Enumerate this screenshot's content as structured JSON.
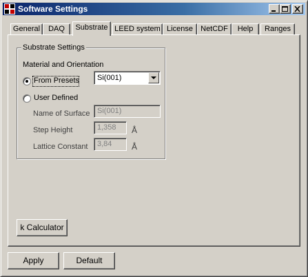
{
  "window": {
    "title": "Software Settings",
    "icons": {
      "app": "settings-app-icon",
      "minimize": "minimize-icon",
      "maximize": "maximize-icon",
      "close": "close-icon"
    }
  },
  "tabs": [
    {
      "label": "General"
    },
    {
      "label": "DAQ"
    },
    {
      "label": "Substrate",
      "active": true
    },
    {
      "label": "LEED system"
    },
    {
      "label": "License"
    },
    {
      "label": "NetCDF"
    },
    {
      "label": "Help"
    },
    {
      "label": "Ranges"
    }
  ],
  "substrate": {
    "group_title": "Substrate Settings",
    "section_label": "Material and Orientation",
    "from_presets_label": "From Presets",
    "from_presets_selected": true,
    "preset_value": "Si(001)",
    "user_defined_label": "User Defined",
    "user_defined_selected": false,
    "name_label": "Name of Surface",
    "name_value": "Si(001)",
    "step_height_label": "Step Height",
    "step_height_value": "1,358",
    "step_height_unit": "Å",
    "lattice_label": "Lattice Constant",
    "lattice_value": "3,84",
    "lattice_unit": "Å",
    "k_calc_label": "k Calculator"
  },
  "footer": {
    "apply_label": "Apply",
    "default_label": "Default"
  },
  "colors": {
    "face": "#d4d0c8",
    "title_active": "#0a246a",
    "title_gradient_end": "#a6caf0",
    "disabled_text": "#808080"
  }
}
